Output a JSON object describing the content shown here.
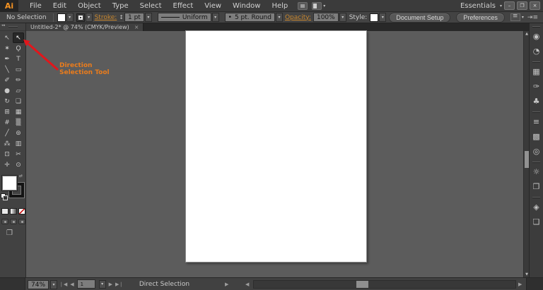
{
  "app": {
    "logo": "Ai",
    "workspace": "Essentials"
  },
  "menus": [
    "File",
    "Edit",
    "Object",
    "Type",
    "Select",
    "Effect",
    "View",
    "Window",
    "Help"
  ],
  "window_controls": {
    "minimize": "–",
    "restore": "❐",
    "close": "×"
  },
  "control_bar": {
    "no_selection_label": "No Selection",
    "stroke_label": "Stroke:",
    "stroke_value": "1 pt",
    "profile_value": "Uniform",
    "brush_dot": "•",
    "brush_value": "5 pt. Round",
    "opacity_label": "Opacity:",
    "opacity_value": "100%",
    "style_label": "Style:",
    "document_setup_button": "Document Setup",
    "preferences_button": "Preferences"
  },
  "document_tab": {
    "title": "Untitled-2* @ 74% (CMYK/Preview)",
    "close": "×"
  },
  "toolbar": {
    "tools": [
      {
        "name": "selection-tool",
        "glyph": "↖",
        "selected": false
      },
      {
        "name": "direct-selection-tool",
        "glyph": "↖",
        "selected": true
      },
      {
        "name": "magic-wand-tool",
        "glyph": "✶",
        "selected": false
      },
      {
        "name": "lasso-tool",
        "glyph": "Ϙ",
        "selected": false
      },
      {
        "name": "pen-tool",
        "glyph": "✒",
        "selected": false
      },
      {
        "name": "type-tool",
        "glyph": "T",
        "selected": false
      },
      {
        "name": "line-segment-tool",
        "glyph": "╲",
        "selected": false
      },
      {
        "name": "rectangle-tool",
        "glyph": "▭",
        "selected": false
      },
      {
        "name": "paintbrush-tool",
        "glyph": "✐",
        "selected": false
      },
      {
        "name": "pencil-tool",
        "glyph": "✏",
        "selected": false
      },
      {
        "name": "blob-brush-tool",
        "glyph": "●",
        "selected": false
      },
      {
        "name": "eraser-tool",
        "glyph": "▱",
        "selected": false
      },
      {
        "name": "rotate-tool",
        "glyph": "↻",
        "selected": false
      },
      {
        "name": "scale-tool",
        "glyph": "❏",
        "selected": false
      },
      {
        "name": "shape-builder-tool",
        "glyph": "⊞",
        "selected": false
      },
      {
        "name": "perspective-grid-tool",
        "glyph": "▦",
        "selected": false
      },
      {
        "name": "mesh-tool",
        "glyph": "#",
        "selected": false
      },
      {
        "name": "gradient-tool",
        "glyph": "▒",
        "selected": false
      },
      {
        "name": "eyedropper-tool",
        "glyph": "╱",
        "selected": false
      },
      {
        "name": "blend-tool",
        "glyph": "⊚",
        "selected": false
      },
      {
        "name": "symbol-sprayer-tool",
        "glyph": "⁂",
        "selected": false
      },
      {
        "name": "column-graph-tool",
        "glyph": "▥",
        "selected": false
      },
      {
        "name": "artboard-tool",
        "glyph": "⊡",
        "selected": false
      },
      {
        "name": "slice-tool",
        "glyph": "✂",
        "selected": false
      },
      {
        "name": "hand-tool",
        "glyph": "✛",
        "selected": false
      },
      {
        "name": "zoom-tool",
        "glyph": "⊙",
        "selected": false
      }
    ]
  },
  "annotation": {
    "line1": "Direction",
    "line2": "Selection Tool"
  },
  "dock": {
    "groups": [
      {
        "panels": [
          {
            "name": "color-panel",
            "glyph": "◉"
          },
          {
            "name": "color-guide-panel",
            "glyph": "◔"
          }
        ]
      },
      {
        "panels": [
          {
            "name": "swatches-panel",
            "glyph": "▦"
          },
          {
            "name": "brushes-panel",
            "glyph": "✑"
          },
          {
            "name": "symbols-panel",
            "glyph": "♣"
          }
        ]
      },
      {
        "panels": [
          {
            "name": "stroke-panel",
            "glyph": "≡"
          },
          {
            "name": "gradient-panel",
            "glyph": "▩"
          },
          {
            "name": "transparency-panel",
            "glyph": "◎"
          }
        ]
      },
      {
        "panels": [
          {
            "name": "appearance-panel",
            "glyph": "☼"
          },
          {
            "name": "graphic-styles-panel",
            "glyph": "❐"
          }
        ]
      },
      {
        "panels": [
          {
            "name": "layers-panel",
            "glyph": "◈"
          },
          {
            "name": "artboards-panel",
            "glyph": "❏"
          }
        ]
      }
    ]
  },
  "status_bar": {
    "zoom_value": "74%",
    "artboard_number": "1",
    "status_text": "Direct Selection"
  },
  "colors": {
    "annotation_text": "#ea7c1c",
    "annotation_arrow": "#e2161b",
    "control_link": "#c9872e",
    "logo": "#f79422",
    "ui_dark": "#424242",
    "canvas": "#5c5c5c",
    "artboard": "#ffffff"
  }
}
